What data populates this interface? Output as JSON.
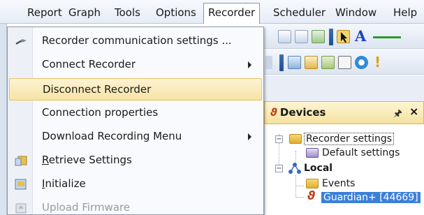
{
  "menubar": {
    "items": [
      "Report",
      "Graph",
      "Tools",
      "Options",
      "Recorder",
      "Scheduler",
      "Window",
      "Help"
    ],
    "active_index": 4
  },
  "recorder_menu": {
    "items": [
      {
        "label": "Recorder communication settings ...",
        "icon": "wrench-icon",
        "submenu": false,
        "enabled": true
      },
      {
        "label": "Connect Recorder",
        "icon": "",
        "submenu": true,
        "enabled": true
      },
      {
        "label": "Disconnect Recorder",
        "icon": "",
        "submenu": false,
        "enabled": true,
        "highlighted": true
      },
      {
        "label": "Connection properties",
        "icon": "",
        "submenu": false,
        "enabled": true
      },
      {
        "label": "Download Recording Menu",
        "icon": "",
        "submenu": true,
        "enabled": true
      },
      {
        "label": "Retrieve Settings",
        "icon": "retrieve-settings-icon",
        "submenu": false,
        "enabled": true
      },
      {
        "label": "Initialize",
        "icon": "initialize-icon",
        "submenu": false,
        "enabled": true
      },
      {
        "label": "Upload Firmware",
        "icon": "upload-firmware-icon",
        "submenu": false,
        "enabled": false
      }
    ]
  },
  "toolbar": {
    "format_a": "A"
  },
  "devices_panel": {
    "title": "Devices",
    "pin": "p",
    "close": "✕",
    "tree": {
      "recorder_settings": "Recorder settings",
      "default_settings": "Default settings",
      "local": "Local",
      "events": "Events",
      "guardian": "Guardian+ [44669]"
    }
  },
  "colors": {
    "highlight": "#f8e3a4",
    "selection": "#3b7fd9",
    "menubar": "#e6ecf6"
  }
}
